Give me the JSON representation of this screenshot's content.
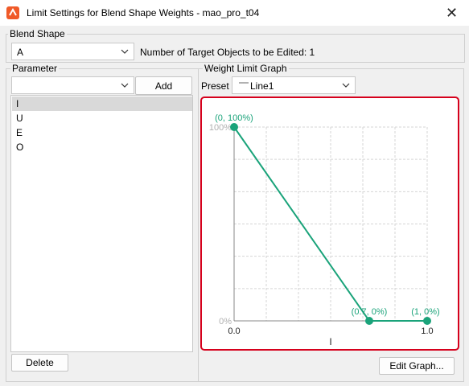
{
  "window": {
    "title": "Limit Settings for Blend Shape Weights - mao_pro_t04",
    "close_glyph": "✕"
  },
  "blend_shape": {
    "group_label": "Blend Shape",
    "selected": "A",
    "target_info": "Number of Target Objects to be Edited: 1"
  },
  "parameter": {
    "group_label": "Parameter",
    "combo_value": "",
    "add_label": "Add",
    "items": [
      "I",
      "U",
      "E",
      "O"
    ],
    "selected_index": 0,
    "delete_label": "Delete"
  },
  "graph_panel": {
    "group_label": "Weight Limit Graph",
    "preset_label": "Preset",
    "preset_value": "Line1",
    "edit_label": "Edit Graph..."
  },
  "chart_data": {
    "type": "line",
    "x": [
      0,
      0.7,
      1
    ],
    "y": [
      100,
      0,
      0
    ],
    "point_labels": [
      "(0, 100%)",
      "(0.7, 0%)",
      "(1, 0%)"
    ],
    "xlim": [
      0,
      1
    ],
    "ylim": [
      0,
      100
    ],
    "x_ticks": [
      "0.0",
      "1.0"
    ],
    "y_ticks": [
      "0%",
      "100%"
    ],
    "xlabel": "I",
    "grid": true,
    "line_color": "#1aa37a",
    "accent_color": "#d6001c"
  }
}
